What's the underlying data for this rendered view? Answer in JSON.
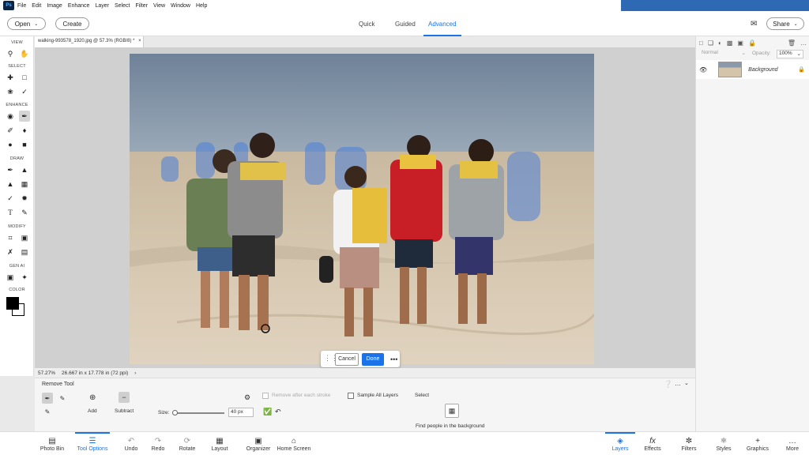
{
  "menu": [
    "File",
    "Edit",
    "Image",
    "Enhance",
    "Layer",
    "Select",
    "Filter",
    "View",
    "Window",
    "Help"
  ],
  "topbar": {
    "open_label": "Open",
    "create_label": "Create",
    "modes": [
      "Quick",
      "Guided",
      "Advanced"
    ],
    "active_mode": "Advanced",
    "share_label": "Share"
  },
  "toolbox": {
    "sections": [
      "VIEW",
      "SELECT",
      "ENHANCE",
      "DRAW",
      "MODIFY",
      "GEN AI",
      "COLOR"
    ]
  },
  "document": {
    "tab_title": "walking-993578_1920.jpg @ 57.3% (RGB/8) *",
    "zoom": "57.27%",
    "dimensions": "26.667 in x 17.778 in (72 ppi)"
  },
  "float_bar": {
    "cancel_label": "Cancel",
    "done_label": "Done",
    "more_label": "•••"
  },
  "tool_options": {
    "tool_name": "Remove Tool",
    "add_label": "Add",
    "subtract_label": "Subtract",
    "size_label": "Size:",
    "size_value": "40 px",
    "remove_after_label": "Remove after each stroke",
    "sample_all_label": "Sample All Layers",
    "select_label": "Select",
    "find_people_label": "Find people in the background"
  },
  "layers_panel": {
    "blend_mode": "Normal",
    "opacity_label": "Opacity:",
    "opacity_value": "100%",
    "layer_name": "Background"
  },
  "bottombar": {
    "left": [
      "Photo Bin",
      "Tool Options",
      "Undo",
      "Redo",
      "Rotate",
      "Layout",
      "Organizer",
      "Home Screen"
    ],
    "right": [
      "Layers",
      "Effects",
      "Filters",
      "Styles",
      "Graphics",
      "More"
    ]
  },
  "colors": {
    "accent": "#1a73e8",
    "sky": "#7e93a8",
    "sand": "#cdbfa8",
    "selection_overlay": "#4a7fd9"
  }
}
